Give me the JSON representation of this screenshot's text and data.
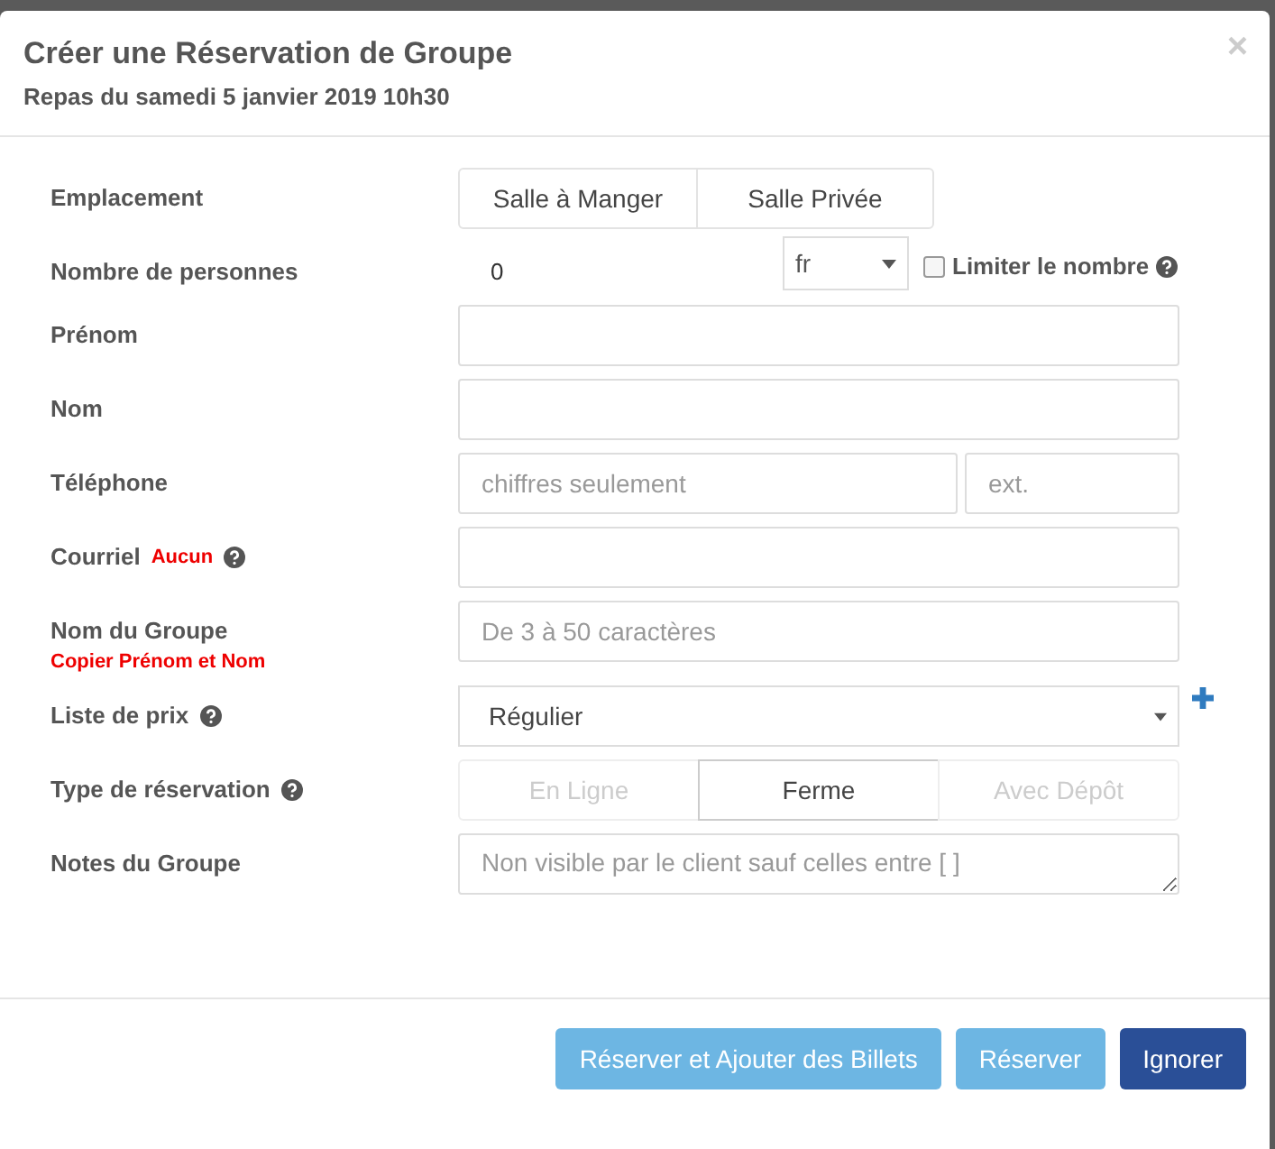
{
  "modal": {
    "title": "Créer une Réservation de Groupe",
    "subtitle": "Repas du samedi 5 janvier 2019 10h30",
    "close": "×"
  },
  "rows": [
    {
      "kind": "toggle",
      "label": "Emplacement",
      "options": [
        {
          "label": "Salle à Manger",
          "selected": false,
          "disabled": false
        },
        {
          "label": "Salle Privée",
          "selected": false,
          "disabled": false
        }
      ]
    },
    {
      "kind": "number",
      "label": "Nombre de personnes",
      "value": "0",
      "select": "fr",
      "checkbox": {
        "label": "Limiter le nombre",
        "checked": false,
        "help": true
      }
    },
    {
      "kind": "text",
      "label": "Prénom"
    },
    {
      "kind": "text",
      "label": "Nom"
    },
    {
      "kind": "phone",
      "label": "Téléphone",
      "placeholder": "chiffres seulement",
      "ext_placeholder": "ext."
    },
    {
      "kind": "text",
      "label": "Courriel",
      "tag": "Aucun",
      "help": true
    },
    {
      "kind": "text",
      "label": "Nom du Groupe",
      "link": "Copier Prénom et Nom",
      "placeholder": "De 3 à 50 caractères"
    },
    {
      "kind": "select",
      "label": "Liste de prix",
      "help": true,
      "value": "Régulier",
      "add": true
    },
    {
      "kind": "toggle",
      "label": "Type de réservation",
      "help": true,
      "options": [
        {
          "label": "En Ligne",
          "selected": false,
          "disabled": true
        },
        {
          "label": "Ferme",
          "selected": true,
          "disabled": false
        },
        {
          "label": "Avec Dépôt",
          "selected": false,
          "disabled": true
        }
      ]
    },
    {
      "kind": "textarea",
      "label": "Notes du Groupe",
      "placeholder": "Non visible par le client sauf celles entre [ ]"
    }
  ],
  "buttons": [
    {
      "label": "Réserver et Ajouter des Billets",
      "kind": "primary",
      "disabled": true
    },
    {
      "label": "Réserver",
      "kind": "primary",
      "disabled": true
    },
    {
      "label": "Ignorer",
      "kind": "dark",
      "disabled": false
    }
  ]
}
